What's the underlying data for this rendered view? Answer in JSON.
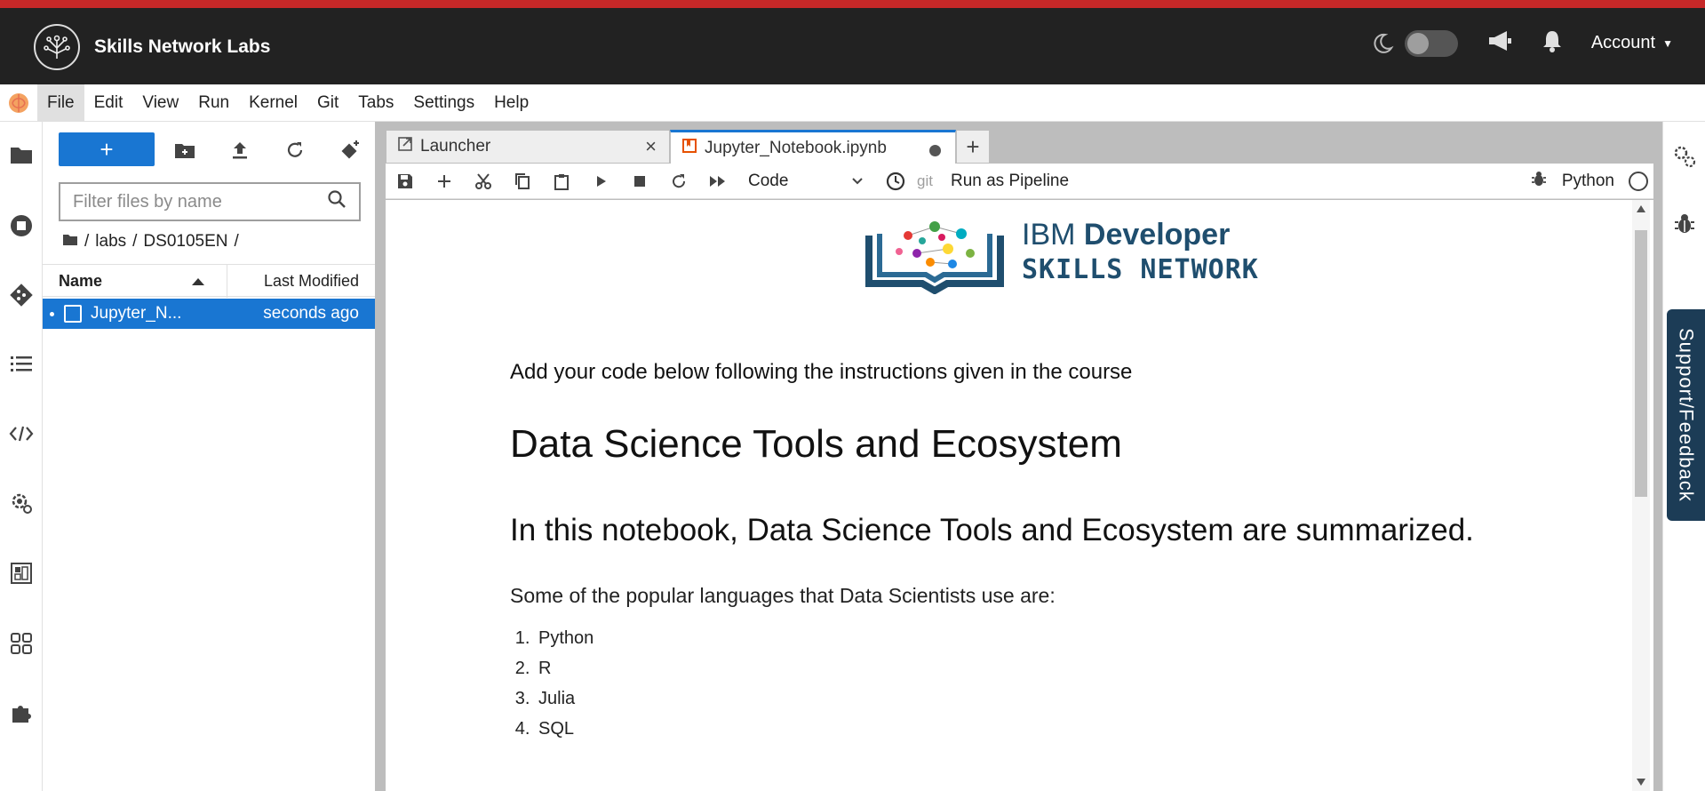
{
  "header": {
    "brand": "Skills Network Labs",
    "account_label": "Account",
    "theme_toggle_on": false
  },
  "menubar": {
    "items": [
      "File",
      "Edit",
      "View",
      "Run",
      "Kernel",
      "Git",
      "Tabs",
      "Settings",
      "Help"
    ],
    "active_item": "File"
  },
  "filebrowser": {
    "new_label": "+",
    "filter_placeholder": "Filter files by name",
    "breadcrumb": [
      "labs",
      "DS0105EN"
    ],
    "columns": {
      "name": "Name",
      "modified": "Last Modified"
    },
    "files": [
      {
        "name": "Jupyter_N...",
        "modified": "seconds ago",
        "selected": true
      }
    ]
  },
  "tabs": [
    {
      "label": "Launcher",
      "active": false
    },
    {
      "label": "Jupyter_Notebook.ipynb",
      "active": true
    }
  ],
  "toolbar": {
    "cell_type": "Code",
    "git_label": "git",
    "pipeline_label": "Run as Pipeline",
    "kernel_name": "Python"
  },
  "notebook": {
    "logo_line1_light": "IBM ",
    "logo_line1_bold": "Developer",
    "logo_line2": "SKILLS NETWORK",
    "intro": "Add your code below following the instructions given in the course",
    "title": "Data Science Tools and Ecosystem",
    "subtitle": "In this notebook, Data Science Tools and Ecosystem are summarized.",
    "languages_intro": "Some of the popular languages that Data Scientists use are:",
    "languages": [
      "Python",
      "R",
      "Julia",
      "SQL"
    ]
  },
  "support_label": "Support/Feedback",
  "colors": {
    "accent": "#1976d2",
    "header_bg": "#222222",
    "header_top_stripe": "#c62828",
    "support_bg": "#1c3c56"
  }
}
